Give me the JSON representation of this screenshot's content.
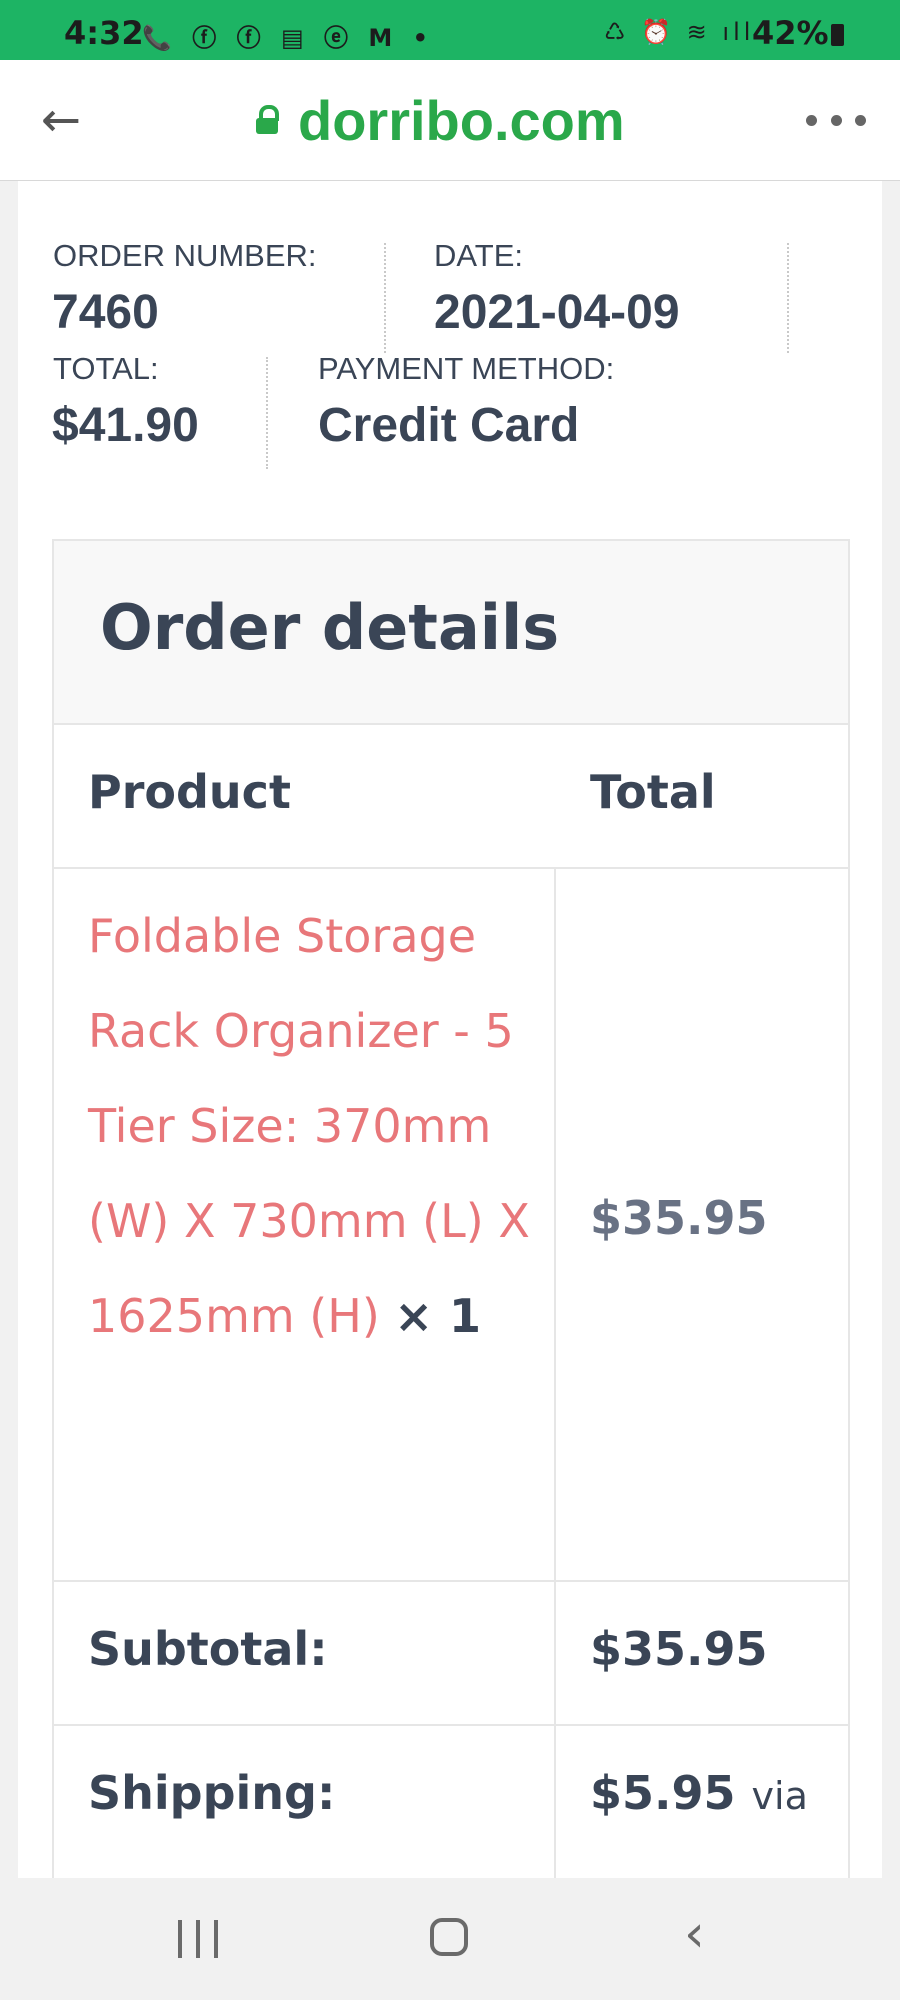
{
  "status_bar": {
    "time": "4:32",
    "left_icons": "📞 ⓕ ⓕ ▤ ⓔ M •",
    "right_icons": "♺ ⏰ ≋ ıll",
    "battery": "42%"
  },
  "browser": {
    "url": "dorribo.com",
    "back_icon": "arrow-left",
    "menu_icon": "more-horizontal"
  },
  "order_meta": {
    "order_number_label": "ORDER NUMBER:",
    "order_number": "7460",
    "date_label": "DATE:",
    "date": "2021-04-09",
    "total_label": "TOTAL:",
    "total": "$41.90",
    "payment_label": "PAYMENT METHOD:",
    "payment": "Credit Card"
  },
  "order_details": {
    "title": "Order details",
    "col_product": "Product",
    "col_total": "Total",
    "items": [
      {
        "name": "Foldable Storage Rack Organizer - 5 Tier Size: 370mm (W) X 730mm (L) X 1625mm (H)",
        "qty": "× 1",
        "total": "$35.95"
      }
    ],
    "subtotal_label": "Subtotal:",
    "subtotal": "$35.95",
    "shipping_label": "Shipping:",
    "shipping_value": "$5.95",
    "shipping_via": "via"
  },
  "colors": {
    "status_bar": "#1db464",
    "url": "#2aa84a",
    "product_link": "#e8777a",
    "text": "#3a4556"
  }
}
